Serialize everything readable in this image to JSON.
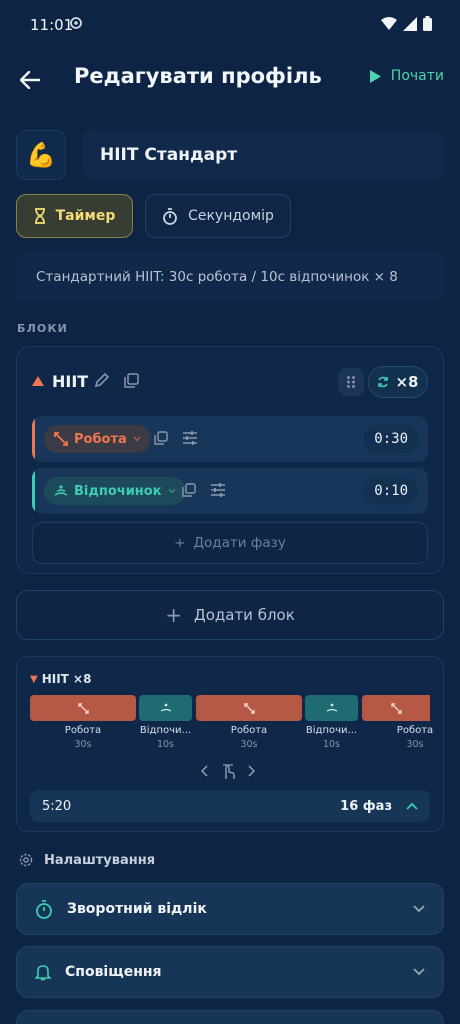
{
  "status_bar": {
    "time": "11:01"
  },
  "topbar": {
    "title": "Редагувати профіль",
    "start_label": "Почати"
  },
  "profile": {
    "emoji": "💪",
    "name": "HIIT Стандарт",
    "description": "Стандартний HIIT: 30с робота / 10с відпочинок × 8"
  },
  "modes": {
    "timer_label": "Таймер",
    "stopwatch_label": "Секундомір",
    "selected": "timer"
  },
  "blocks_label": "БЛОКИ",
  "block": {
    "name": "HIIT",
    "repeat": "×8",
    "phases": [
      {
        "label": "Робота",
        "time": "0:30",
        "color": "#f07650"
      },
      {
        "label": "Відпочинок",
        "time": "0:10",
        "color": "#3ccdb4"
      }
    ],
    "add_phase_label": "Додати фазу"
  },
  "add_block_label": "Додати блок",
  "preview": {
    "title": "HIIT ×8",
    "segments": [
      {
        "label": "Робота",
        "duration": "30s",
        "type": "work"
      },
      {
        "label": "Відпочи...",
        "duration": "10s",
        "type": "rest"
      },
      {
        "label": "Робота",
        "duration": "30s",
        "type": "work"
      },
      {
        "label": "Відпочи...",
        "duration": "10s",
        "type": "rest"
      },
      {
        "label": "Робота",
        "duration": "30s",
        "type": "work"
      }
    ],
    "total_time": "5:20",
    "phase_count": "16 фаз"
  },
  "settings": {
    "title": "Налаштування",
    "rows": [
      {
        "label": "Зворотний відлік",
        "icon": "stopwatch-icon"
      },
      {
        "label": "Сповіщення",
        "icon": "bell-icon"
      }
    ]
  },
  "colors": {
    "work": "#b65846",
    "rest": "#1f6b74",
    "accent": "#4ed3ae",
    "timer_active": "#f4dc78"
  }
}
